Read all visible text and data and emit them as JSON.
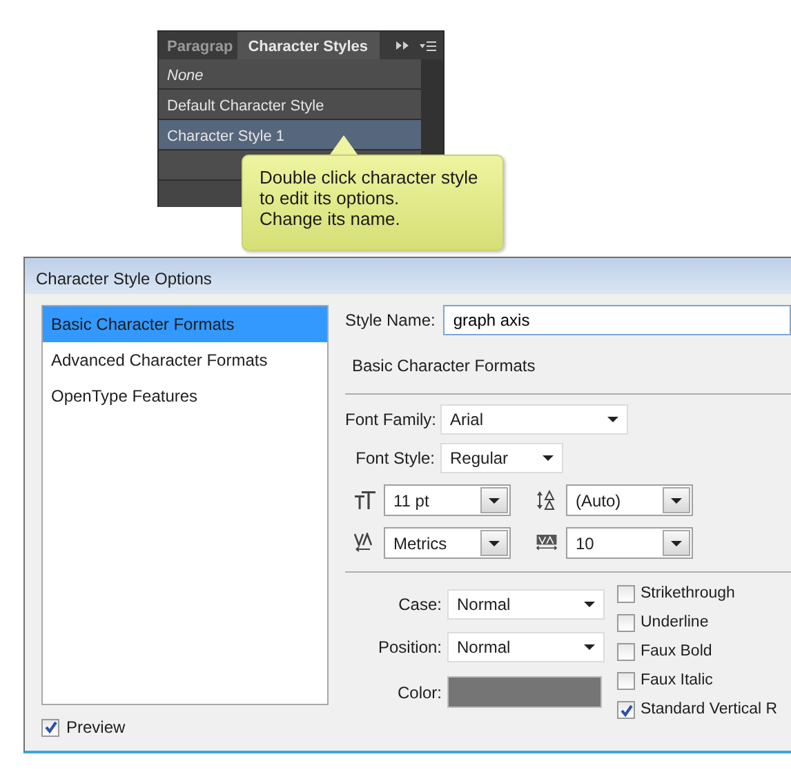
{
  "panel": {
    "tabs": [
      {
        "label": "Paragrap",
        "selected": false
      },
      {
        "label": "Character Styles",
        "selected": true
      }
    ],
    "styles": [
      {
        "label": "None",
        "italic": true,
        "selected": false
      },
      {
        "label": "Default Character Style",
        "italic": false,
        "selected": false
      },
      {
        "label": "Character Style 1",
        "italic": false,
        "selected": true
      }
    ]
  },
  "callout": {
    "lines": [
      "Double click character style",
      "to edit its options.",
      "Change its name."
    ]
  },
  "dialog": {
    "title": "Character Style Options",
    "categories": [
      {
        "label": "Basic Character Formats",
        "selected": true
      },
      {
        "label": "Advanced Character Formats",
        "selected": false
      },
      {
        "label": "OpenType Features",
        "selected": false
      }
    ],
    "style_name": {
      "label": "Style Name:",
      "value": "graph axis"
    },
    "section_title": "Basic Character Formats",
    "font_family": {
      "label": "Font Family:",
      "value": "Arial"
    },
    "font_style": {
      "label": "Font Style:",
      "value": "Regular"
    },
    "metrics": [
      {
        "kind": "size",
        "value": "11 pt"
      },
      {
        "kind": "leading",
        "value": "(Auto)"
      },
      {
        "kind": "kerning",
        "value": "Metrics"
      },
      {
        "kind": "tracking",
        "value": "10"
      }
    ],
    "case": {
      "label": "Case:",
      "value": "Normal"
    },
    "position": {
      "label": "Position:",
      "value": "Normal"
    },
    "color": {
      "label": "Color:",
      "color": "#757575"
    },
    "checkboxes": [
      {
        "label": "Strikethrough",
        "checked": false
      },
      {
        "label": "Underline",
        "checked": false
      },
      {
        "label": "Faux Bold",
        "checked": false
      },
      {
        "label": "Faux Italic",
        "checked": false
      },
      {
        "label": "Standard Vertical R",
        "checked": true
      }
    ],
    "preview": {
      "label": "Preview",
      "checked": true
    }
  }
}
